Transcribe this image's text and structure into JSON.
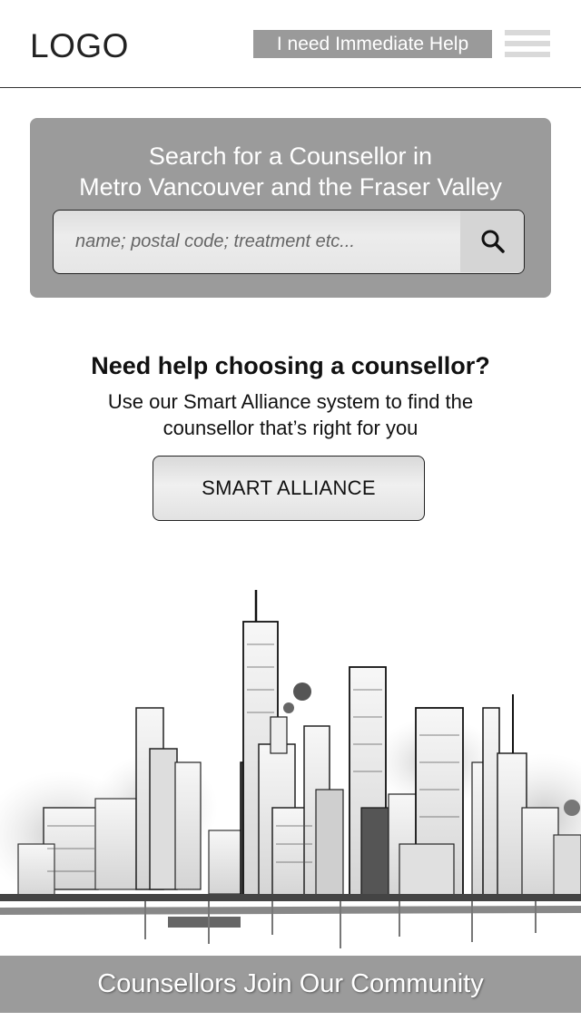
{
  "header": {
    "logo": "LOGO",
    "help_button": "I need Immediate Help",
    "menu_icon": "hamburger-menu-icon"
  },
  "search": {
    "title_line1": "Search for a Counsellor in",
    "title_line2": "Metro Vancouver and the Fraser Valley",
    "placeholder": "name; postal code; treatment etc...",
    "value": "",
    "button_icon": "search-icon"
  },
  "help": {
    "heading": "Need help choosing a counsellor?",
    "text_line1": "Use our Smart Alliance system to find the",
    "text_line2": "counsellor that’s right for you",
    "button": "SMART ALLIANCE"
  },
  "hero": {
    "image": "city-skyline-illustration"
  },
  "footer": {
    "cta": "Counsellors Join Our Community"
  },
  "colors": {
    "panel_gray": "#9b9b9b",
    "menu_bar": "#d9d9d9",
    "text_dark": "#111111",
    "text_light": "#ffffff"
  }
}
